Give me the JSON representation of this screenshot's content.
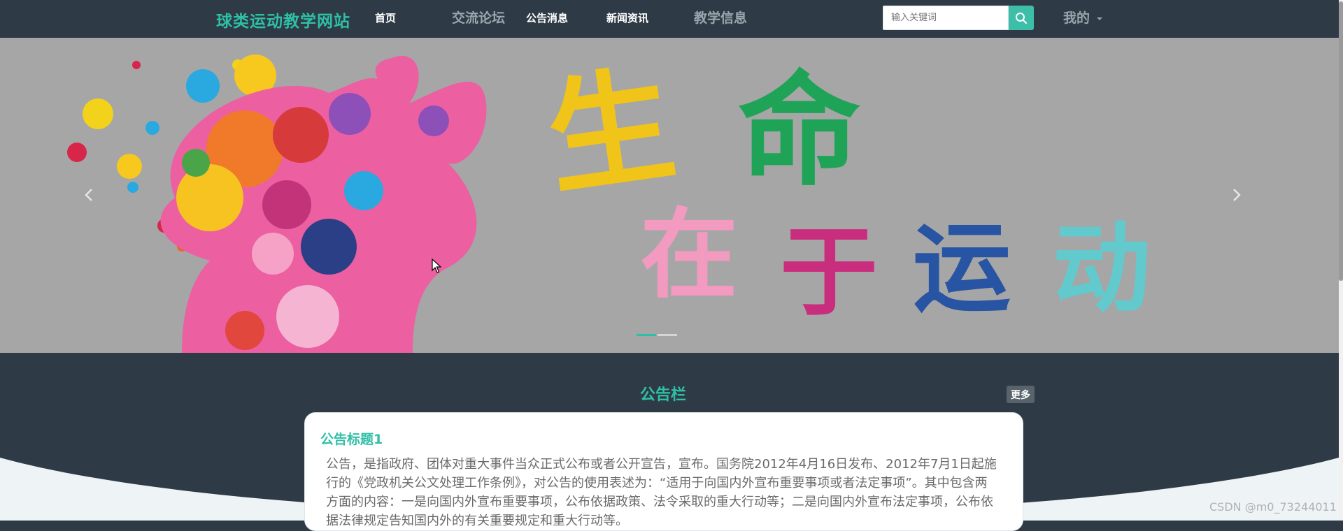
{
  "header": {
    "logo": "球类运动教学网站",
    "nav": [
      "首页",
      "交流论坛",
      "公告消息",
      "新闻资讯",
      "教学信息"
    ],
    "search": {
      "placeholder": "输入关键词",
      "icon": "search-icon"
    },
    "user_menu": "我的"
  },
  "banner": {
    "slogan": "生命在于运动",
    "slide_count": 2,
    "active_slide": 1,
    "prev_icon": "chevron-left-icon",
    "next_icon": "chevron-right-icon"
  },
  "notice_board": {
    "title": "公告栏",
    "more_label": "更多",
    "items": [
      {
        "title": "公告标题1",
        "content": "公告，是指政府、团体对重大事件当众正式公布或者公开宣告，宣布。国务院2012年4月16日发布、2012年7月1日起施行的《党政机关公文处理工作条例》，对公告的使用表述为：“适用于向国内外宣布重要事项或者法定事项”。其中包含两方面的内容：一是向国内外宣布重要事项，公布依据政策、法令采取的重大行动等；二是向国内外宣布法定事项，公布依据法律规定告知国内外的有关重要规定和重大行动等。"
      }
    ]
  },
  "watermark": "CSDN @m0_73244011",
  "colors": {
    "accent": "#2fbfa6",
    "nav_bg": "#2e3a45",
    "banner_bg": "#a6a6a6"
  }
}
